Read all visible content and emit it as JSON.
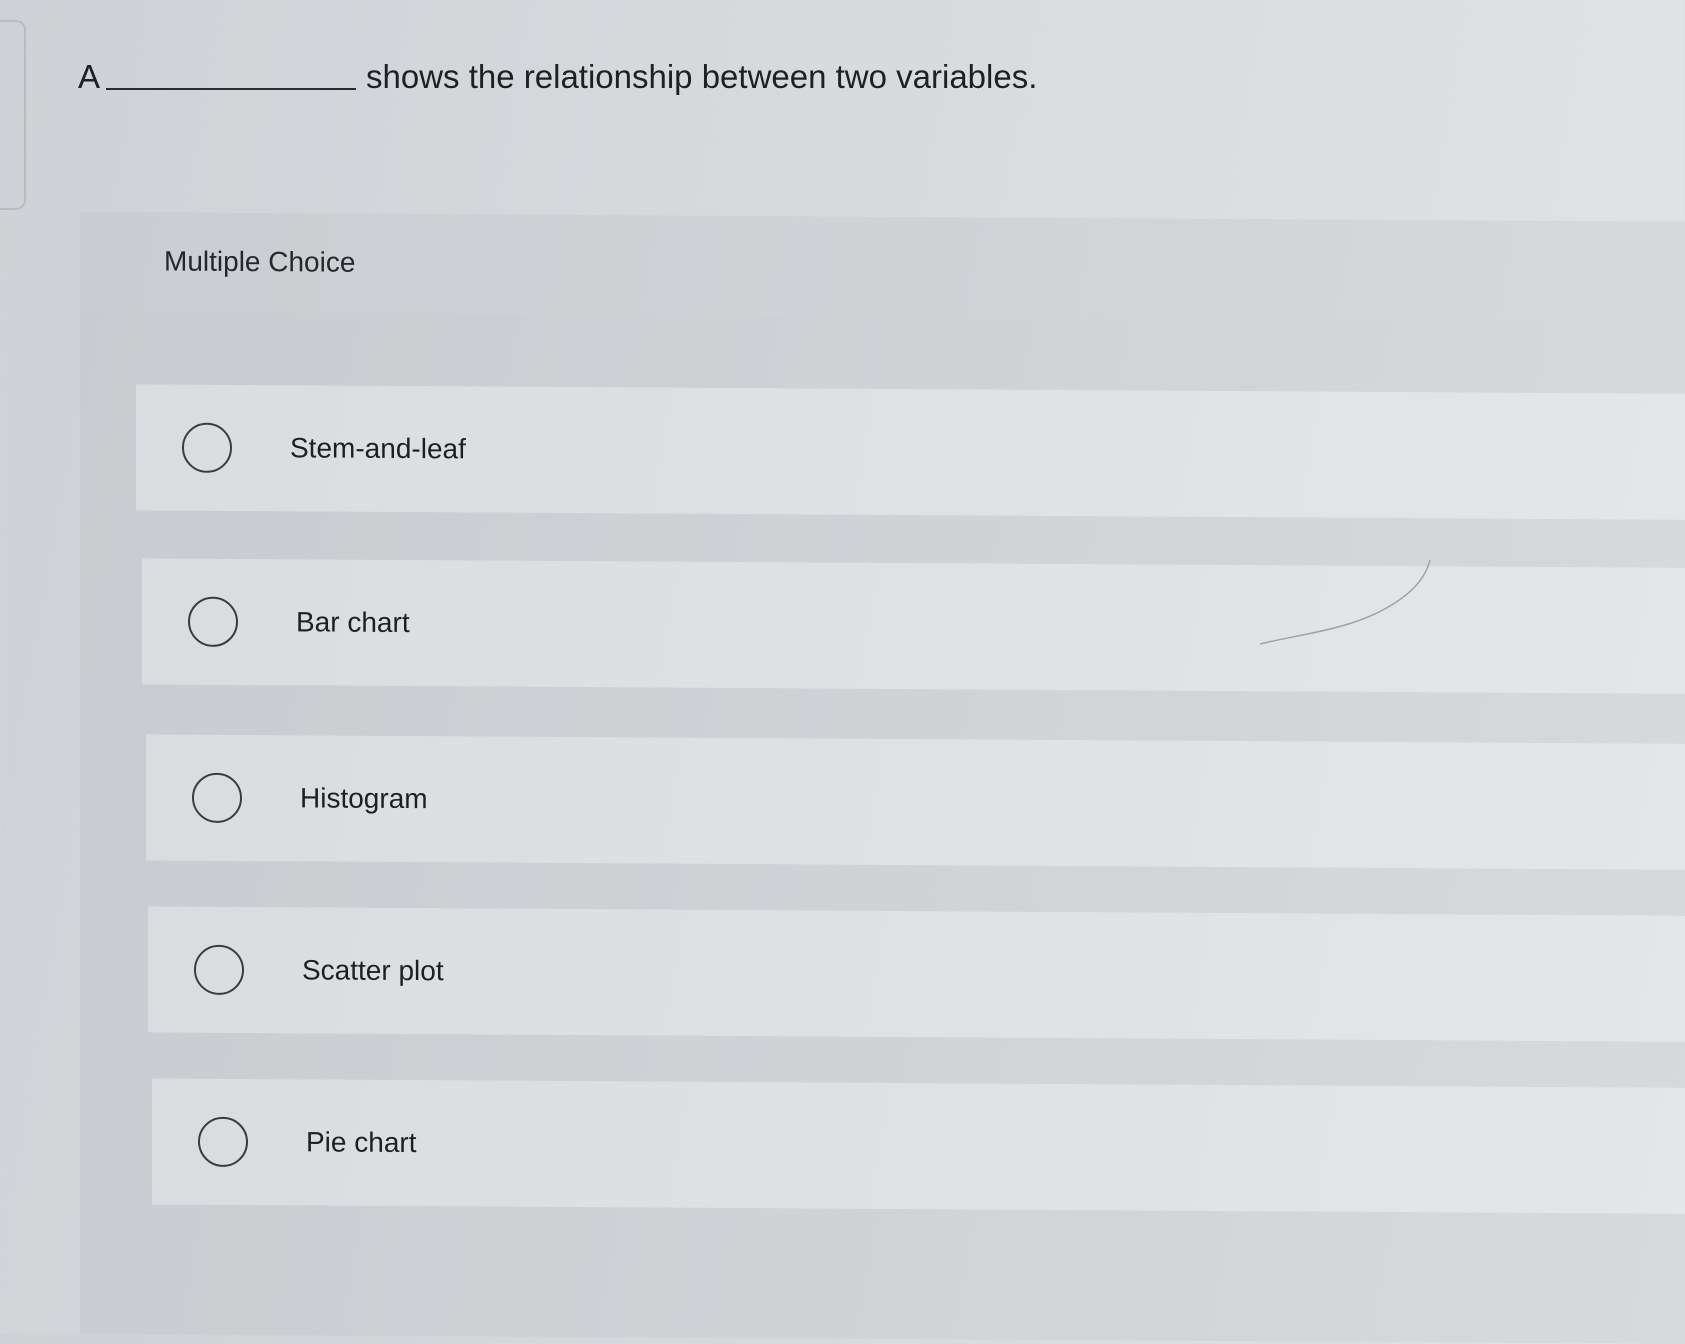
{
  "question": {
    "prefix": "A",
    "suffix": "shows the relationship between two variables."
  },
  "multiple_choice": {
    "title": "Multiple Choice",
    "options": [
      {
        "label": "Stem-and-leaf",
        "selected": false
      },
      {
        "label": "Bar chart",
        "selected": false
      },
      {
        "label": "Histogram",
        "selected": false
      },
      {
        "label": "Scatter plot",
        "selected": false
      },
      {
        "label": "Pie chart",
        "selected": false
      }
    ]
  }
}
